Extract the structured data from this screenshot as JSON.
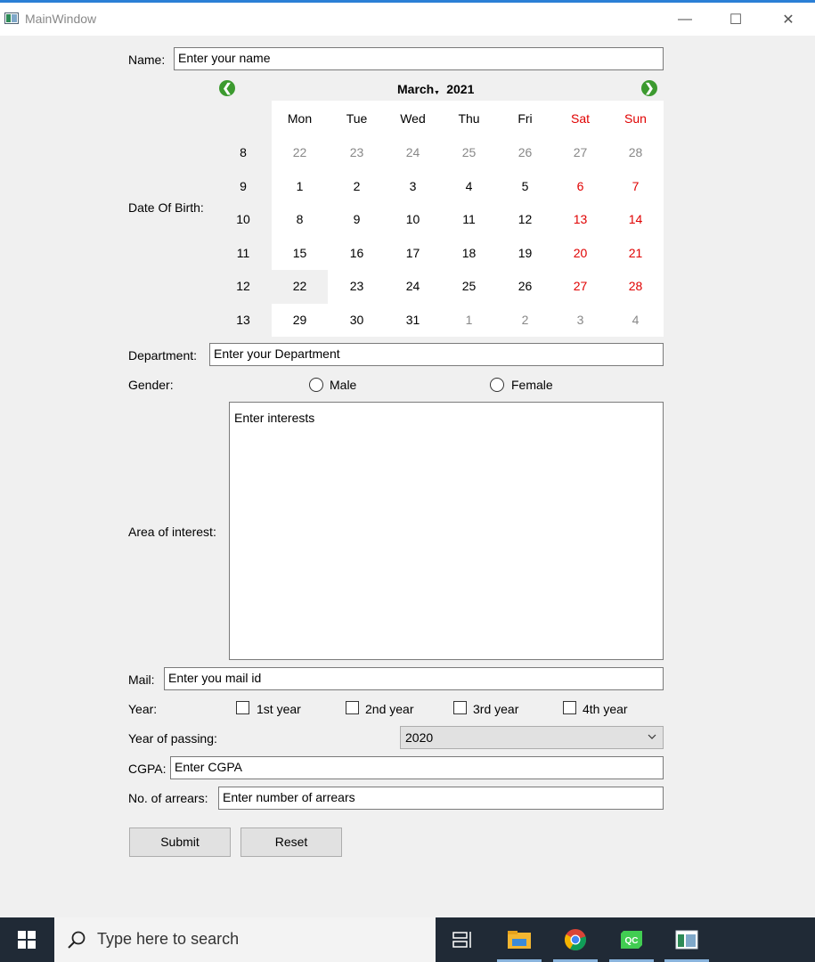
{
  "window": {
    "title": "MainWindow",
    "minimize_glyph": "—",
    "maximize_glyph": "☐",
    "close_glyph": "✕"
  },
  "form": {
    "name_label": "Name:",
    "name_placeholder": "Enter your name",
    "dob_label": "Date Of Birth:",
    "department_label": "Department:",
    "department_placeholder": "Enter your Department",
    "gender_label": "Gender:",
    "gender_options": [
      "Male",
      "Female"
    ],
    "interest_label": "Area of interest:",
    "interest_placeholder": "Enter interests",
    "mail_label": "Mail:",
    "mail_placeholder": "Enter you mail id",
    "year_label": "Year:",
    "year_options": [
      "1st year",
      "2nd year",
      "3rd year",
      "4th year"
    ],
    "passing_label": "Year of passing:",
    "passing_value": "2020",
    "cgpa_label": "CGPA:",
    "cgpa_placeholder": "Enter CGPA",
    "arrears_label": "No. of arrears:",
    "arrears_placeholder": "Enter number of arrears",
    "submit_label": "Submit",
    "reset_label": "Reset"
  },
  "calendar": {
    "month": "March",
    "year": "2021",
    "prev_glyph": "❮",
    "next_glyph": "❯",
    "day_headers": [
      "Mon",
      "Tue",
      "Wed",
      "Thu",
      "Fri",
      "Sat",
      "Sun"
    ],
    "weeks": [
      {
        "week": "8",
        "days": [
          "22",
          "23",
          "24",
          "25",
          "26",
          "27",
          "28"
        ]
      },
      {
        "week": "9",
        "days": [
          "1",
          "2",
          "3",
          "4",
          "5",
          "6",
          "7"
        ]
      },
      {
        "week": "10",
        "days": [
          "8",
          "9",
          "10",
          "11",
          "12",
          "13",
          "14"
        ]
      },
      {
        "week": "11",
        "days": [
          "15",
          "16",
          "17",
          "18",
          "19",
          "20",
          "21"
        ]
      },
      {
        "week": "12",
        "days": [
          "22",
          "23",
          "24",
          "25",
          "26",
          "27",
          "28"
        ]
      },
      {
        "week": "13",
        "days": [
          "29",
          "30",
          "31",
          "1",
          "2",
          "3",
          "4"
        ]
      }
    ],
    "selected_date": "22",
    "weekend_color": "#e00000",
    "accent_color": "#3c9a2f"
  },
  "taskbar": {
    "search_placeholder": "Type here to search",
    "icons": [
      "windows-start-icon",
      "task-view-icon",
      "file-explorer-icon",
      "chrome-icon",
      "qt-creator-icon",
      "mainwindow-app-icon"
    ]
  }
}
